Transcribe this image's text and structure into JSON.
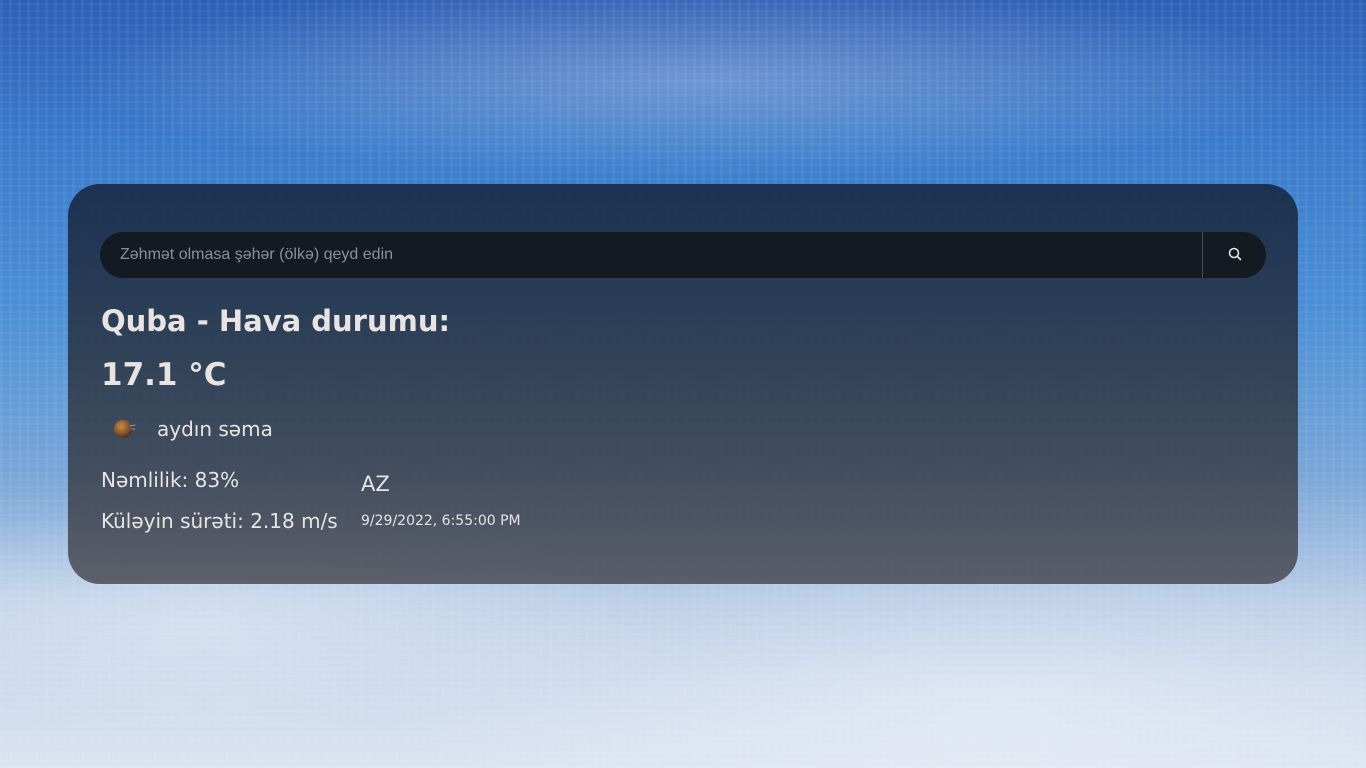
{
  "search": {
    "placeholder": "Zəhmət olmasa şəhər (ölkə) qeyd edin",
    "value": "",
    "button_icon": "search-icon"
  },
  "weather": {
    "title": "Quba - Hava durumu:",
    "temperature": "17.1 °C",
    "icon": "clear-sky-moon-icon",
    "description": "aydın səma",
    "humidity": "Nəmlilik: 83%",
    "wind_speed": "Küləyin sürəti: 2.18 m/s",
    "country": "AZ",
    "datetime": "9/29/2022, 6:55:00 PM"
  },
  "colors": {
    "card_bg": "#1c2c44",
    "search_bg": "#131a22",
    "text": "#e9e4e2",
    "placeholder": "#8b9199"
  }
}
